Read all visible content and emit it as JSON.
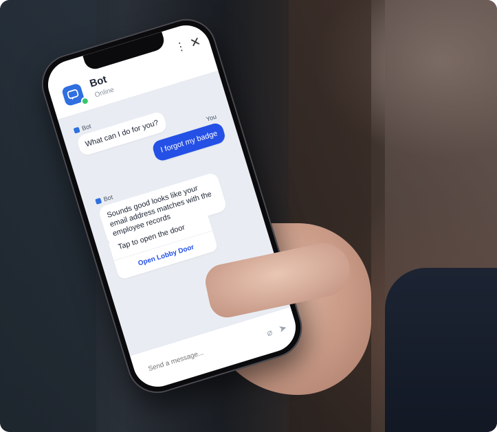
{
  "chat": {
    "bot_name": "Bot",
    "bot_status": "Online",
    "messages": {
      "bot_label_1": "Bot",
      "bot_msg_1": "What can I do for you?",
      "user_label": "You",
      "user_msg_1": "I forgot my badge",
      "bot_label_2": "Bot",
      "bot_msg_2": "Sounds good looks like your email address matches with the employee records"
    },
    "card": {
      "text": "Tap to open the door",
      "button_label": "Open Lobby Door"
    },
    "composer": {
      "placeholder": "Send a message..."
    }
  },
  "colors": {
    "accent": "#2450e6",
    "online": "#38c76b"
  }
}
